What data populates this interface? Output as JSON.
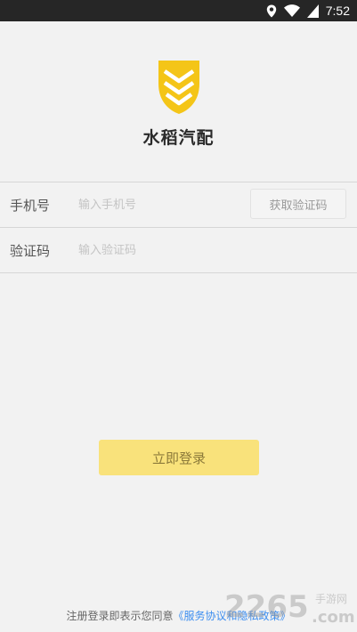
{
  "status_bar": {
    "time": "7:52"
  },
  "app": {
    "name": "水稻汽配"
  },
  "form": {
    "phone": {
      "label": "手机号",
      "placeholder": "输入手机号",
      "value": "",
      "code_button": "获取验证码"
    },
    "code": {
      "label": "验证码",
      "placeholder": "输入验证码",
      "value": ""
    }
  },
  "login_button": "立即登录",
  "agreement": {
    "prefix": "注册登录即表示您同意",
    "link": "《服务协议和隐私政策》"
  },
  "watermark": {
    "brand": "2265",
    "suffix": ".com",
    "tagline": "手游网"
  },
  "colors": {
    "logo": "#f4c518",
    "login_button": "#f9e27b",
    "link": "#3d8ef0",
    "status_bar": "#262626"
  }
}
